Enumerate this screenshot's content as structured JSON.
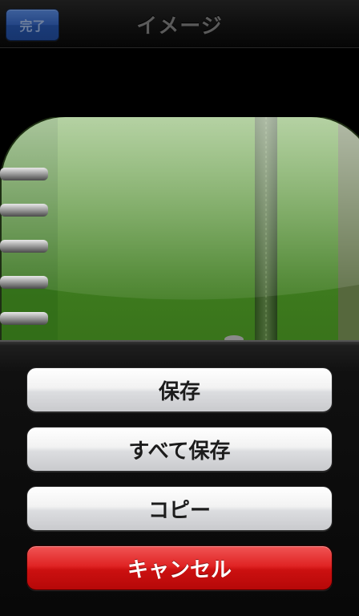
{
  "navbar": {
    "done_label": "完了",
    "title": "イメージ"
  },
  "image": {
    "icon": "notebook-app-icon"
  },
  "action_sheet": {
    "save_label": "保存",
    "save_all_label": "すべて保存",
    "copy_label": "コピー",
    "cancel_label": "キャンセル"
  },
  "colors": {
    "done_button": "#2c58ad",
    "cancel_button": "#e02525",
    "notebook_green": "#3d7a1c"
  }
}
